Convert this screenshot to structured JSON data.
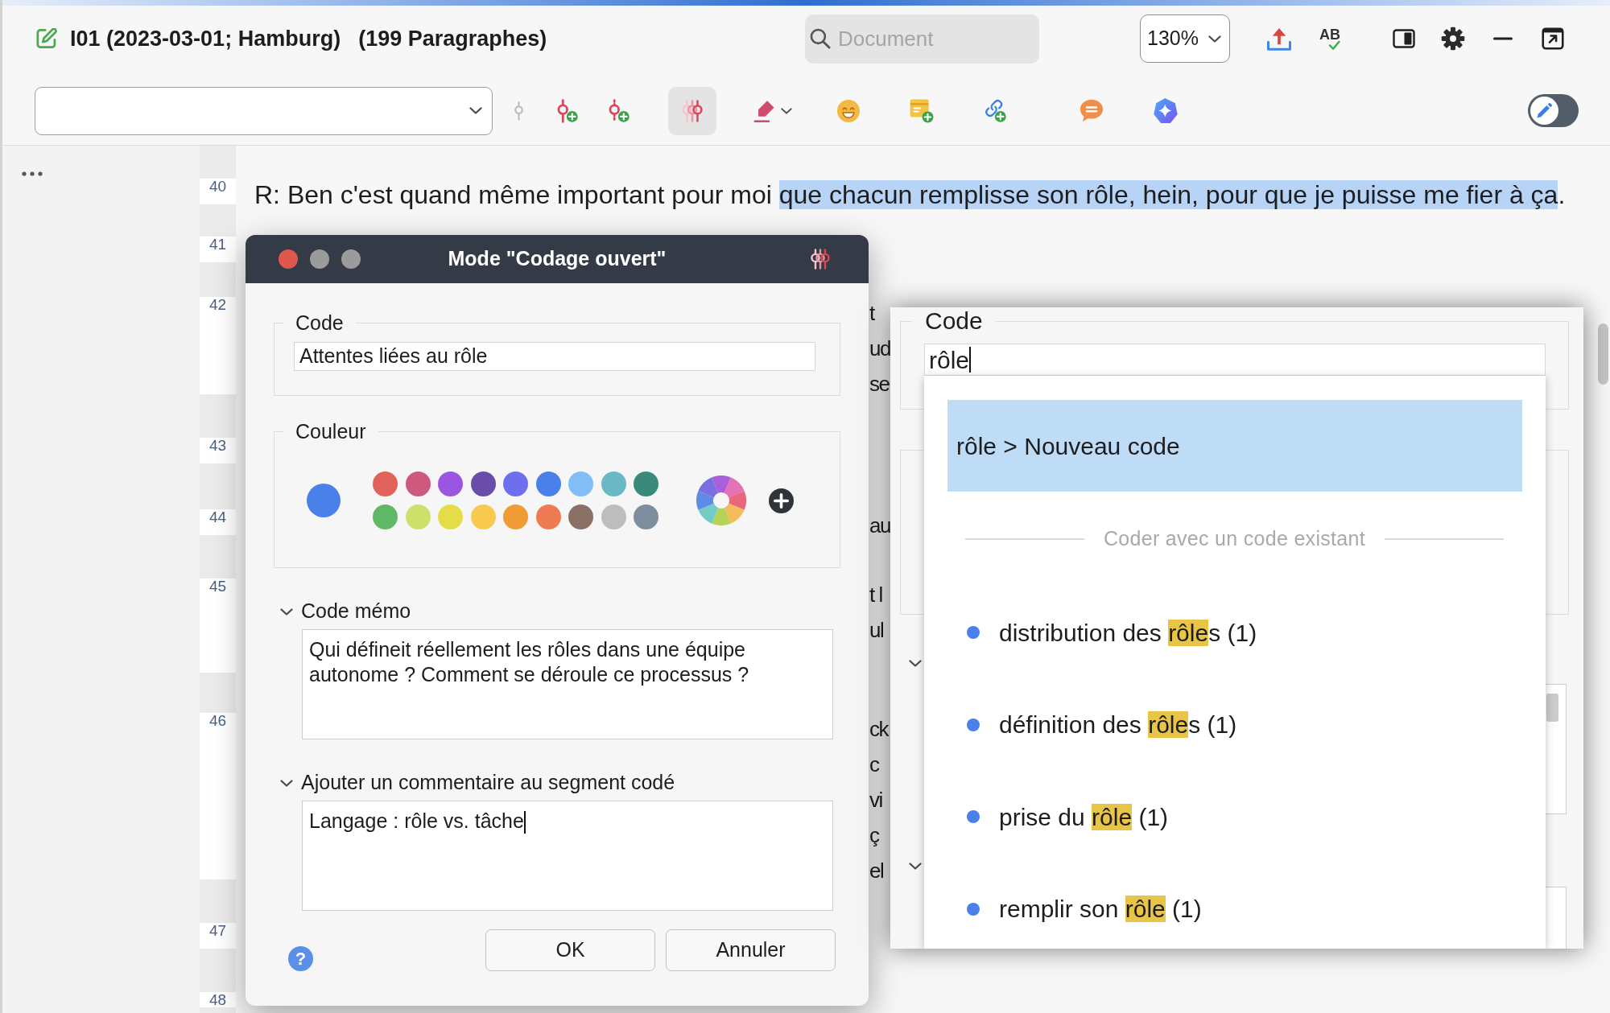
{
  "window": {
    "title": "I01 (2023-03-01; Hamburg)",
    "paragraph_count": "(199 Paragraphes)"
  },
  "search": {
    "placeholder": "Document"
  },
  "zoom": {
    "value": "130%"
  },
  "spellcheck": {
    "label": "AB"
  },
  "toolbar": {
    "tools": [
      {
        "selected": false,
        "disabled": true
      },
      {
        "selected": false,
        "disabled": false
      },
      {
        "selected": false,
        "disabled": false
      },
      {
        "selected": true,
        "disabled": false
      },
      {
        "selected": false,
        "disabled": false
      },
      {
        "selected": false,
        "disabled": false
      },
      {
        "selected": false,
        "disabled": false
      },
      {
        "selected": false,
        "disabled": false
      },
      {
        "selected": false,
        "disabled": false
      },
      {
        "selected": false,
        "disabled": false
      }
    ]
  },
  "edit_toggle": {
    "on": false
  },
  "document": {
    "paragraphs": [
      {
        "number": "40",
        "segments": [
          {
            "text": "R: Ben c'est quand même important pour moi ",
            "highlighted": false
          },
          {
            "text": "que chacun remplisse son rôle, hein, pour que je puisse me fier à ça",
            "highlighted": true
          },
          {
            "text": ".",
            "highlighted": false
          }
        ]
      },
      {
        "number": "41"
      },
      {
        "number": "42",
        "fragments": [
          "t",
          "ud",
          "se"
        ]
      },
      {
        "number": "43"
      },
      {
        "number": "44",
        "fragments": [
          "au"
        ]
      },
      {
        "number": "45",
        "fragments": [
          "t l",
          "ul"
        ]
      },
      {
        "number": "46",
        "fragments": [
          "ck",
          "c",
          "vi",
          "ç",
          "el"
        ]
      },
      {
        "number": "47"
      },
      {
        "number": "48"
      }
    ]
  },
  "coding_dialog": {
    "title": "Mode \"Codage ouvert\"",
    "code_label": "Code",
    "code_value": "Attentes liées au rôle",
    "color_label": "Couleur",
    "current_swatch": {
      "color": "#4a80ea"
    },
    "swatches": [
      {
        "color": "#e0625a"
      },
      {
        "color": "#cd5a7e"
      },
      {
        "color": "#9b55e3"
      },
      {
        "color": "#6a4da8"
      },
      {
        "color": "#6d6fef"
      },
      {
        "color": "#4a80ea"
      },
      {
        "color": "#82bdf7"
      },
      {
        "color": "#6ab8c6"
      },
      {
        "color": "#3a8a7a"
      },
      {
        "color": "#5fb865"
      },
      {
        "color": "#cde06c"
      },
      {
        "color": "#e5dc4a"
      },
      {
        "color": "#f7c94c"
      },
      {
        "color": "#f09c35"
      },
      {
        "color": "#ee7b51"
      },
      {
        "color": "#8a6f64"
      },
      {
        "color": "#bdbdbd"
      },
      {
        "color": "#7d8e9e"
      }
    ],
    "sections": [
      {
        "label": "Code mémo",
        "expanded": true,
        "text": "Qui défineit réellement les rôles dans une équipe autonome ? Comment se déroule ce processus ?",
        "focused": false
      },
      {
        "label": "Ajouter un commentaire au segment codé",
        "expanded": true,
        "text": "Langage : rôle vs. tâche",
        "focused": true
      }
    ],
    "help_label": "?",
    "buttons": [
      {
        "label": "OK"
      },
      {
        "label": "Annuler"
      }
    ]
  },
  "code_panel": {
    "code_label": "Code",
    "code_value": "rôle",
    "focused": true,
    "suggestions": {
      "new_code": {
        "label": "rôle > Nouveau code",
        "selected": true
      },
      "divider_label": "Coder avec un code existant",
      "options": [
        {
          "parts": [
            {
              "text": "distribution des ",
              "match": false
            },
            {
              "text": "rôle",
              "match": true
            },
            {
              "text": "s (1)",
              "match": false
            }
          ],
          "selected": false
        },
        {
          "parts": [
            {
              "text": "définition des ",
              "match": false
            },
            {
              "text": "rôle",
              "match": true
            },
            {
              "text": "s (1)",
              "match": false
            }
          ],
          "selected": false
        },
        {
          "parts": [
            {
              "text": "prise du ",
              "match": false
            },
            {
              "text": "rôle",
              "match": true
            },
            {
              "text": " (1)",
              "match": false
            }
          ],
          "selected": false
        },
        {
          "parts": [
            {
              "text": "remplir son ",
              "match": false
            },
            {
              "text": "rôle",
              "match": true
            },
            {
              "text": " (1)",
              "match": false
            }
          ],
          "selected": false
        }
      ]
    }
  }
}
